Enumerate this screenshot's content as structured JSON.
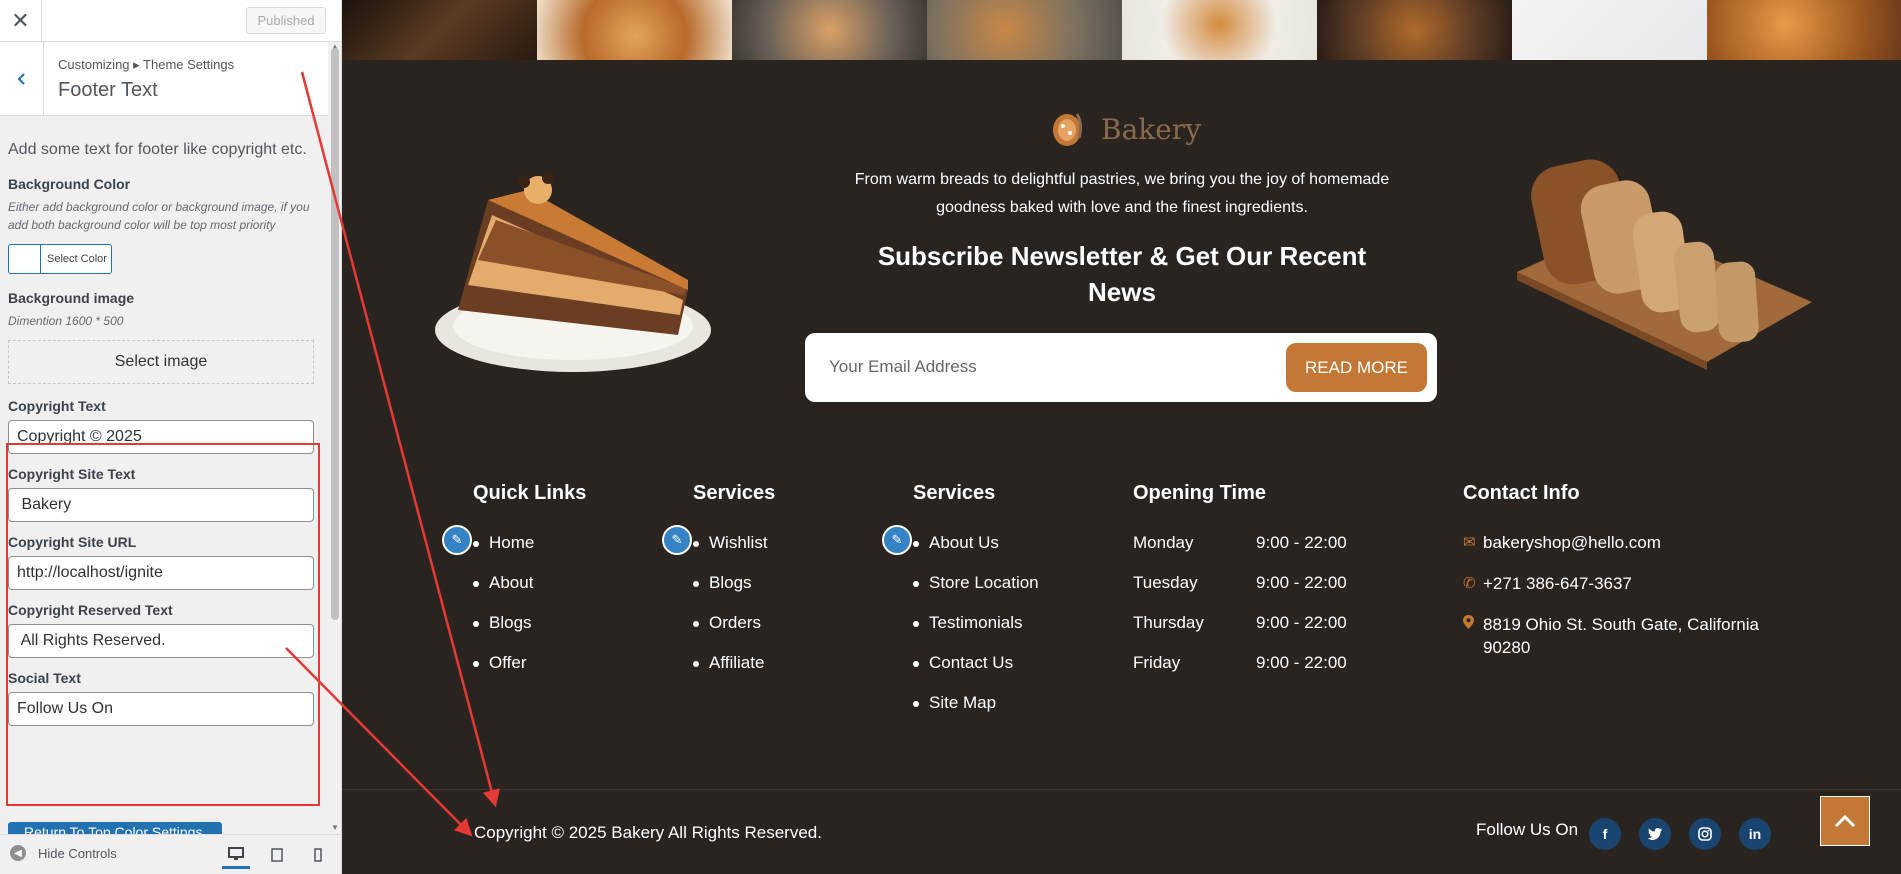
{
  "customizer": {
    "published_label": "Published",
    "breadcrumb": "Customizing ▸ Theme Settings",
    "section_title": "Footer Text",
    "description": "Add some text for footer like copyright etc.",
    "background_color": {
      "label": "Background Color",
      "note": "Either add background color or background image, if you add both background color will be top most priority",
      "button": "Select Color"
    },
    "background_image": {
      "label": "Background image",
      "note": "Dimention 1600 * 500",
      "button": "Select image"
    },
    "fields": [
      {
        "label": "Copyright Text",
        "value": "Copyright © 2025"
      },
      {
        "label": "Copyright Site Text",
        "value": " Bakery"
      },
      {
        "label": "Copyright Site URL",
        "value": "http://localhost/ignite"
      },
      {
        "label": "Copyright Reserved Text",
        "value": " All Rights Reserved."
      },
      {
        "label": "Social Text",
        "value": "Follow Us On"
      }
    ],
    "bottom_button": "Return To Top Color Settings",
    "hide_controls": "Hide Controls"
  },
  "preview": {
    "logo_text": "Bakery",
    "intro": "From warm breads to delightful pastries, we bring you the joy of homemade goodness baked with love and the finest ingredients.",
    "newsletter_title": "Subscribe Newsletter & Get Our Recent News",
    "email_placeholder": "Your Email Address",
    "read_more": "READ MORE",
    "quick_links": {
      "title": "Quick Links",
      "items": [
        "Home",
        "About",
        "Blogs",
        "Offer"
      ]
    },
    "services_1": {
      "title": "Services",
      "items": [
        "Wishlist",
        "Blogs",
        "Orders",
        "Affiliate"
      ]
    },
    "services_2": {
      "title": "Services",
      "items": [
        "About Us",
        "Store Location",
        "Testimonials",
        "Contact Us",
        "Site Map"
      ]
    },
    "opening": {
      "title": "Opening Time",
      "rows": [
        {
          "day": "Monday",
          "hours": "9:00 - 22:00"
        },
        {
          "day": "Tuesday",
          "hours": "9:00 - 22:00"
        },
        {
          "day": "Thursday",
          "hours": "9:00 - 22:00"
        },
        {
          "day": "Friday",
          "hours": "9:00 - 22:00"
        }
      ]
    },
    "contact": {
      "title": "Contact Info",
      "email": "bakeryshop@hello.com",
      "phone": "+271 386-647-3637",
      "address": "8819 Ohio St. South Gate, California 90280"
    },
    "copyright": "Copyright © 2025 Bakery All Rights Reserved.",
    "follow_text": "Follow Us On",
    "social_icons": [
      "facebook-icon",
      "twitter-icon",
      "instagram-icon",
      "linkedin-icon"
    ]
  },
  "colors": {
    "footer_bg": "#2a2420",
    "accent": "#c37836",
    "wp_blue": "#2271b1",
    "annotation_red": "#e53935"
  }
}
